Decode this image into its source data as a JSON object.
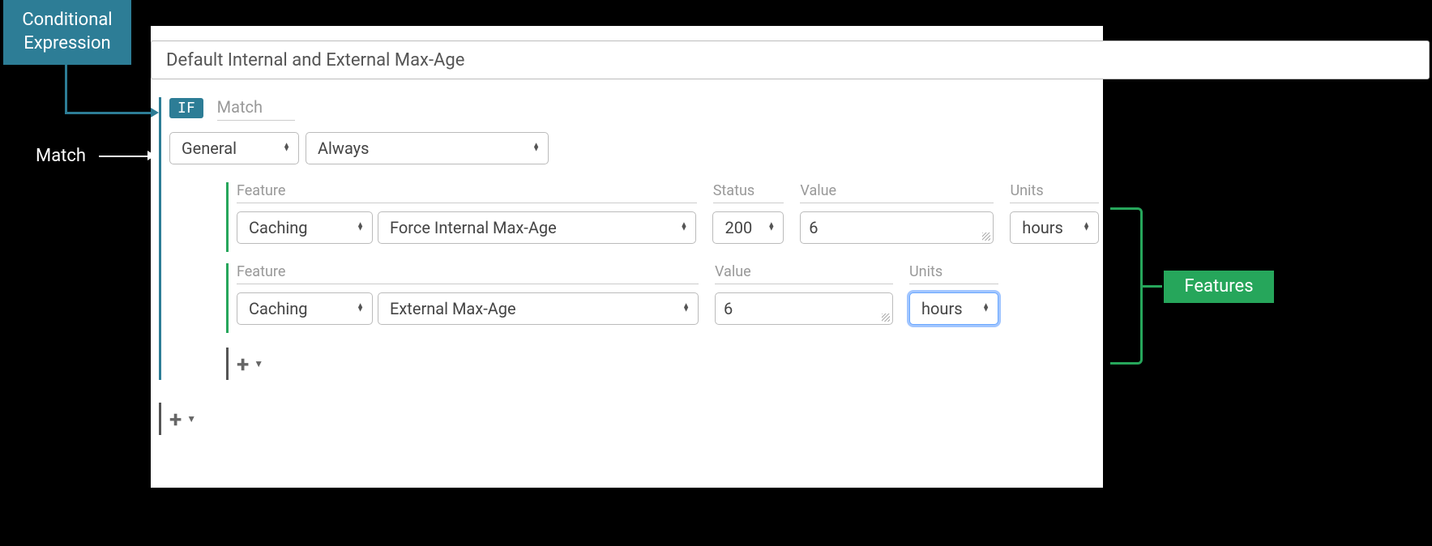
{
  "annotations": {
    "conditional_line1": "Conditional",
    "conditional_line2": "Expression",
    "match": "Match",
    "features": "Features"
  },
  "title": "Default Internal and External Max-Age",
  "if_badge": "IF",
  "match_header": "Match",
  "match_row": {
    "category": "General",
    "condition": "Always"
  },
  "feature_rows": [
    {
      "labels": {
        "feature": "Feature",
        "status": "Status",
        "value": "Value",
        "units": "Units"
      },
      "category": "Caching",
      "name": "Force Internal Max-Age",
      "status": "200",
      "value": "6",
      "units": "hours"
    },
    {
      "labels": {
        "feature": "Feature",
        "value": "Value",
        "units": "Units"
      },
      "category": "Caching",
      "name": "External Max-Age",
      "value": "6",
      "units": "hours"
    }
  ],
  "add_button": "+"
}
